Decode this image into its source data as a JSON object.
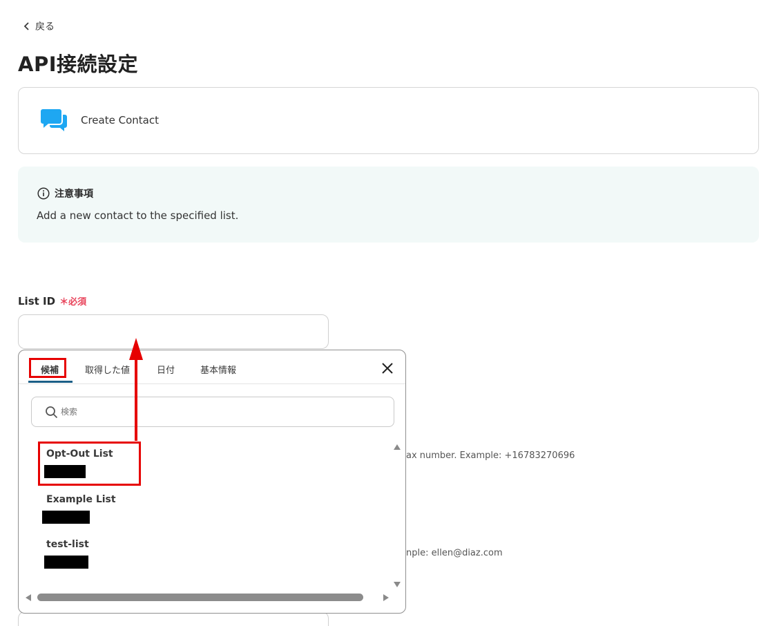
{
  "nav": {
    "back_label": "戻る"
  },
  "page": {
    "title": "API接続設定"
  },
  "action": {
    "name": "Create Contact",
    "icon": "chat-bubbles-icon",
    "icon_color": "#1ea7f2"
  },
  "notice": {
    "heading": "注意事項",
    "body": "Add a new contact to the specified list.",
    "icon": "info-icon"
  },
  "field": {
    "label": "List ID",
    "required_label": "＊必須",
    "value": ""
  },
  "background_hints": {
    "fax": "ax number. Example: +16783270696",
    "email": "nple: ellen@diaz.com"
  },
  "dropdown": {
    "tabs": [
      {
        "label": "候補"
      },
      {
        "label": "取得した値"
      },
      {
        "label": "日付"
      },
      {
        "label": "基本情報"
      }
    ],
    "active_tab": "候補",
    "search_placeholder": "検索",
    "options": [
      {
        "name": "Opt-Out List"
      },
      {
        "name": "Example List"
      },
      {
        "name": "test-list"
      }
    ]
  },
  "colors": {
    "accent": "#1b5f87",
    "annotation": "#e60000",
    "required": "#e8435a"
  }
}
